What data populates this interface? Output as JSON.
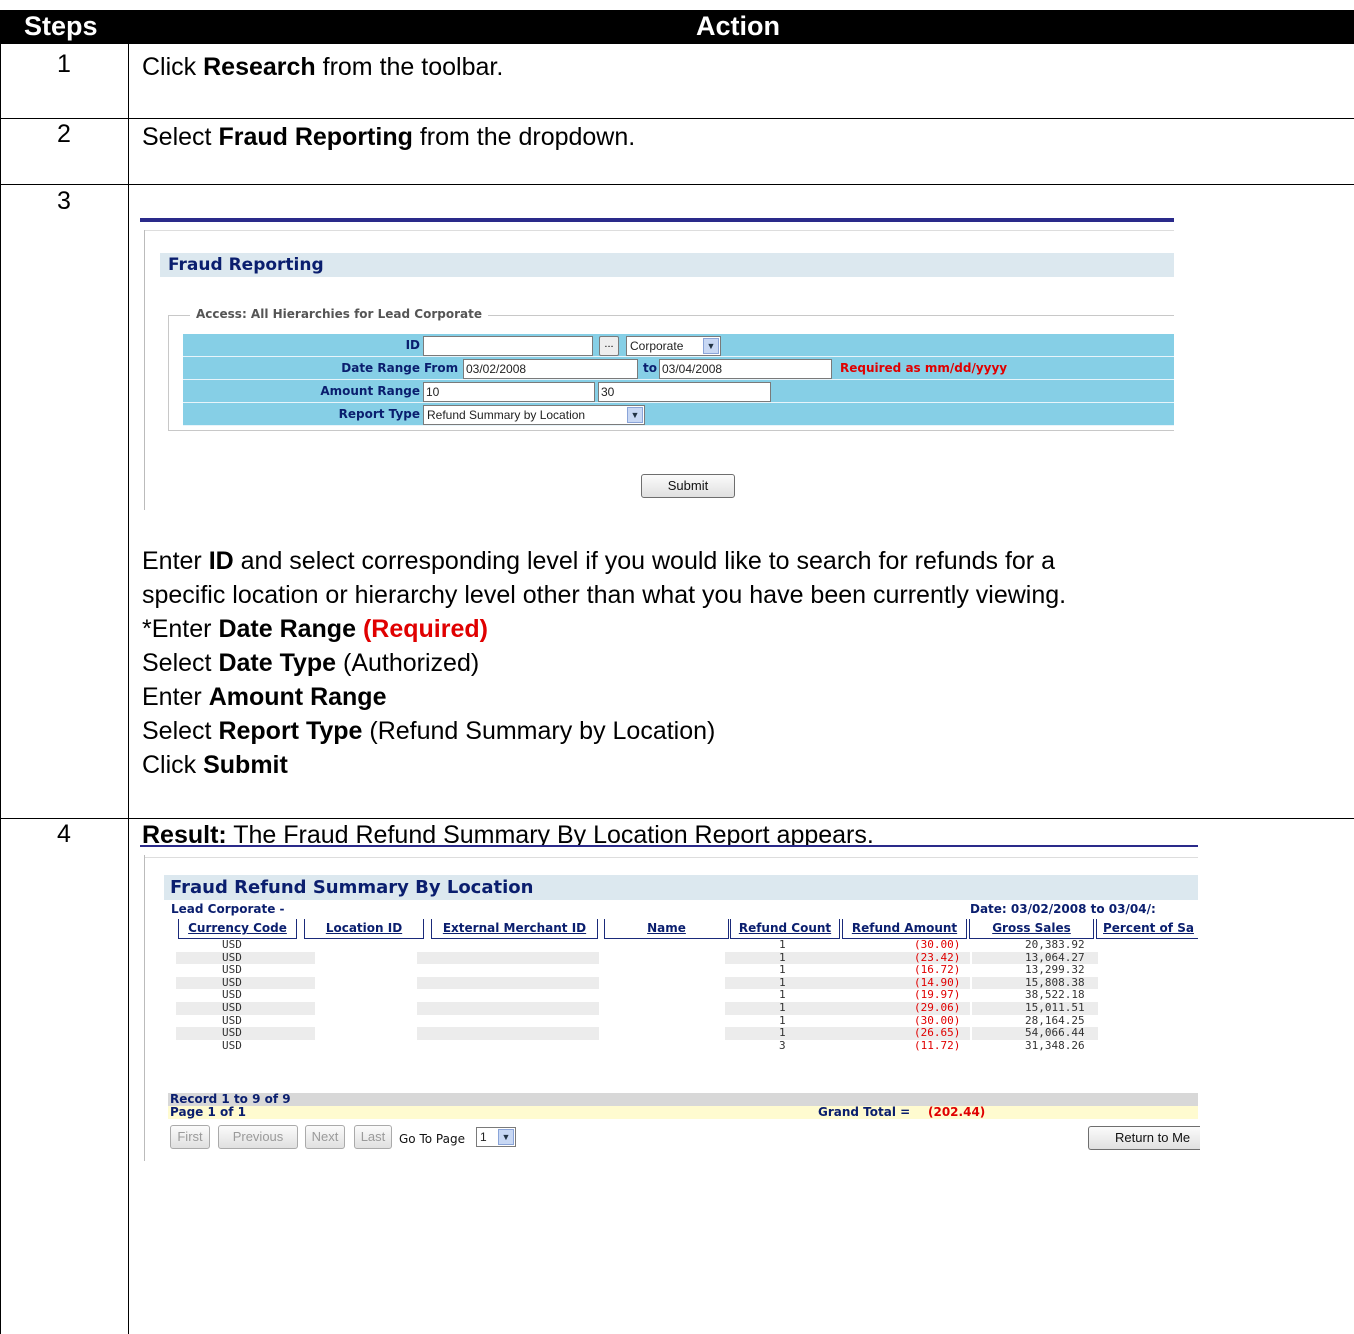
{
  "header": {
    "steps": "Steps",
    "action": "Action"
  },
  "steps": [
    {
      "num": "1",
      "pre": "Click ",
      "bold": "Research",
      "post": " from the toolbar."
    },
    {
      "num": "2",
      "pre": "Select ",
      "bold": "Fraud Reporting",
      "post": " from the dropdown."
    },
    {
      "num": "3"
    },
    {
      "num": "4"
    }
  ],
  "step3_text": {
    "l1a": "Enter ",
    "l1b": "ID",
    "l1c": " and select corresponding level if you would like to search for refunds for a",
    "l2": "specific location or hierarchy level other than what you have been currently viewing.",
    "l3a": "*Enter ",
    "l3b": "Date Range",
    "l3c": "(Required)",
    "l4a": "Select ",
    "l4b": "Date Type",
    "l4c": " (Authorized)",
    "l5a": "Enter ",
    "l5b": "Amount Range",
    "l6a": "Select ",
    "l6b": "Report Type",
    "l6c": " (Refund Summary by Location)",
    "l7a": "Click ",
    "l7b": "Submit"
  },
  "step4_text": {
    "a": "Result:",
    "b": " The Fraud Refund Summary By Location Report appears."
  },
  "fraud_form": {
    "title": "Fraud Reporting",
    "legend": "Access: All Hierarchies for Lead Corporate",
    "id_label": "ID",
    "id_value": "",
    "browse": "...",
    "level": "Corporate",
    "date_label": "Date Range",
    "from_label": "From",
    "from_value": "03/02/2008",
    "to_label": "to",
    "to_value": "03/04/2008",
    "required_note": "Required as mm/dd/yyyy",
    "amount_label": "Amount Range",
    "amount_min": "10",
    "amount_max": "30",
    "report_label": "Report Type",
    "report_value": "Refund Summary by Location",
    "submit": "Submit"
  },
  "report": {
    "title": "Fraud Refund Summary By Location",
    "entity": "Lead Corporate -",
    "date_range": "Date: 03/02/2008 to 03/04/:",
    "columns": [
      "Currency Code",
      "Location ID",
      "External Merchant ID",
      "Name",
      "Refund Count",
      "Refund Amount",
      "Gross Sales",
      "Percent of Sa"
    ],
    "rows": [
      {
        "currency": "USD",
        "count": "1",
        "amount": "(30.00)",
        "gross": "20,383.92"
      },
      {
        "currency": "USD",
        "count": "1",
        "amount": "(23.42)",
        "gross": "13,064.27"
      },
      {
        "currency": "USD",
        "count": "1",
        "amount": "(16.72)",
        "gross": "13,299.32"
      },
      {
        "currency": "USD",
        "count": "1",
        "amount": "(14.90)",
        "gross": "15,808.38"
      },
      {
        "currency": "USD",
        "count": "1",
        "amount": "(19.97)",
        "gross": "38,522.18"
      },
      {
        "currency": "USD",
        "count": "1",
        "amount": "(29.06)",
        "gross": "15,011.51"
      },
      {
        "currency": "USD",
        "count": "1",
        "amount": "(30.00)",
        "gross": "28,164.25"
      },
      {
        "currency": "USD",
        "count": "1",
        "amount": "(26.65)",
        "gross": "54,066.44"
      },
      {
        "currency": "USD",
        "count": "3",
        "amount": "(11.72)",
        "gross": "31,348.26"
      }
    ],
    "record_text": "Record 1 to 9 of 9",
    "page_text": "Page 1 of 1",
    "grand_total_label": "Grand Total =",
    "grand_total_value": "(202.44)",
    "pager": {
      "first": "First",
      "previous": "Previous",
      "next": "Next",
      "last": "Last",
      "goto": "Go To Page",
      "page": "1"
    },
    "return_button": "Return to Me"
  },
  "colors": {
    "header_bg": "#000000",
    "title_band": "#dce8ef",
    "form_row": "#86cfe6",
    "navy": "#0a1e6e",
    "error_red": "#e00000",
    "footer_yellow": "#fffbd0",
    "footer_gray": "#d8d8d8"
  }
}
